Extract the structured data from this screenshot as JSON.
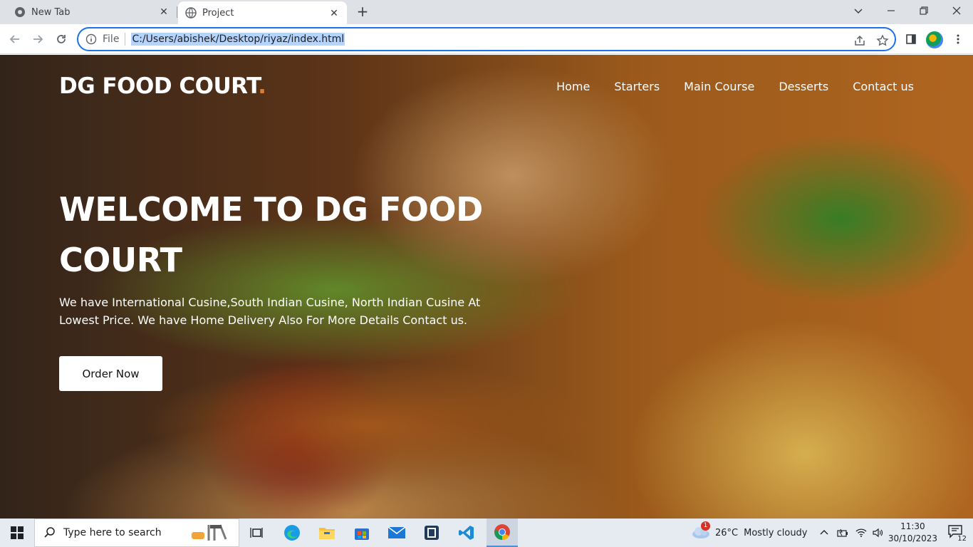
{
  "browser": {
    "tabs": [
      {
        "title": "New Tab",
        "active": false
      },
      {
        "title": "Project",
        "active": true
      }
    ],
    "address": {
      "scheme_label": "File",
      "url": "C:/Users/abishek/Desktop/riyaz/index.html"
    }
  },
  "site": {
    "brand": "DG FOOD COURT",
    "brand_dot": ".",
    "nav": [
      "Home",
      "Starters",
      "Main Course",
      "Desserts",
      "Contact us"
    ],
    "hero": {
      "title_line1": "WELCOME TO DG FOOD",
      "title_line2": "COURT",
      "text_line1": "We have International Cusine,South Indian Cusine, North Indian Cusine At",
      "text_line2": "Lowest Price. We have Home Delivery Also For More Details Contact us.",
      "cta": "Order Now"
    },
    "colors": {
      "accent": "#e07a2e",
      "text": "#ffffff"
    }
  },
  "taskbar": {
    "search_placeholder": "Type here to search",
    "weather": {
      "temp": "26°C",
      "condition": "Mostly cloudy",
      "badge": "1"
    },
    "time": "11:30",
    "date": "30/10/2023",
    "notifications": "12"
  }
}
